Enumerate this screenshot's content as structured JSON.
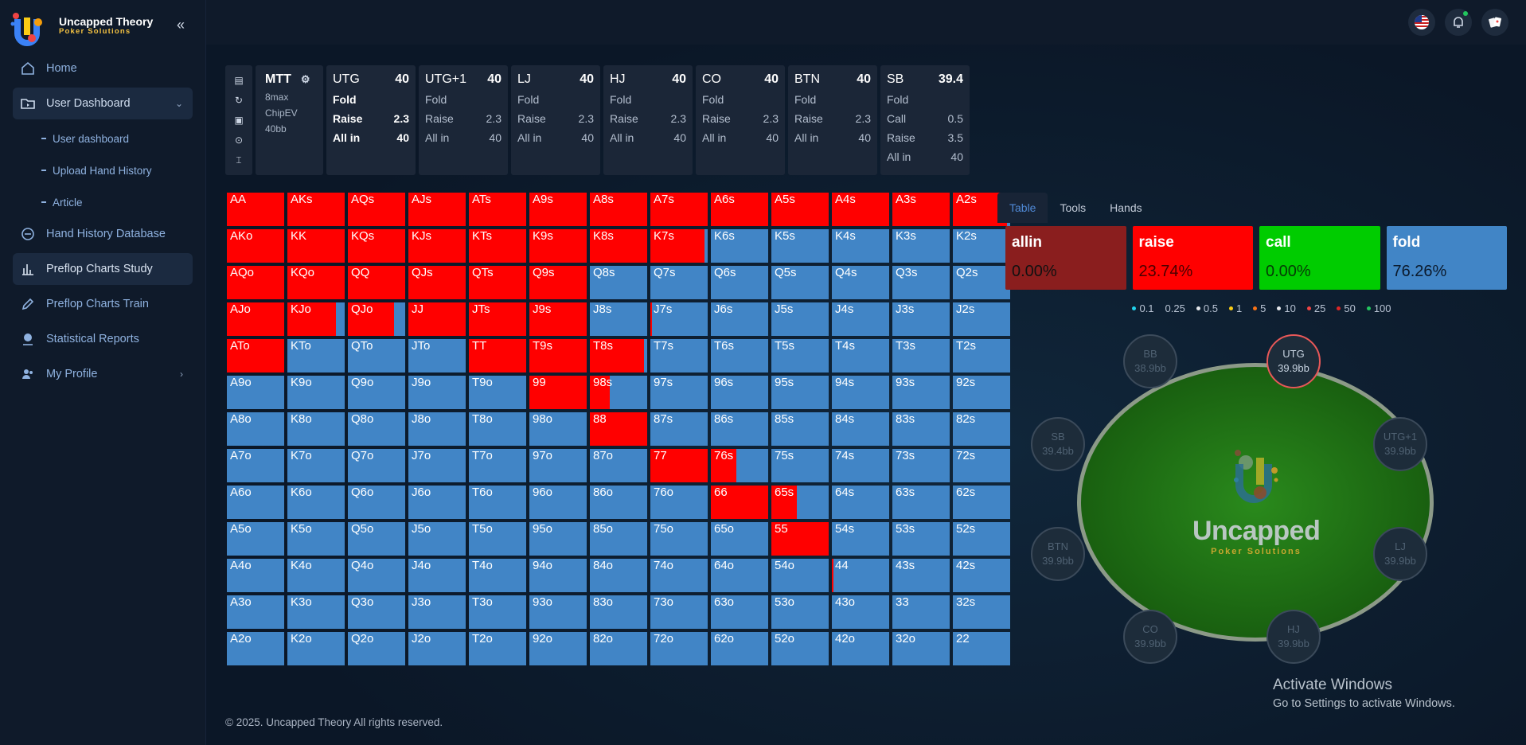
{
  "brand": {
    "title": "Uncapped Theory",
    "subtitle": "Poker Solutions"
  },
  "nav": {
    "home": "Home",
    "user_dashboard": "User Dashboard",
    "sub": [
      "User dashboard",
      "Upload Hand History",
      "Article"
    ],
    "hand_history_db": "Hand History Database",
    "preflop_study": "Preflop Charts Study",
    "preflop_train": "Preflop Charts Train",
    "statistical_reports": "Statistical Reports",
    "my_profile": "My Profile"
  },
  "icons": {
    "collapse": "double-chevron-left-icon",
    "flag": "us-flag-icon",
    "bell": "bell-icon",
    "cards": "cards-icon"
  },
  "game": {
    "title": "MTT",
    "format": "8max",
    "ev": "ChipEV",
    "depth": "40bb"
  },
  "positions": [
    {
      "name": "UTG",
      "stack": "40",
      "active": true,
      "options": [
        [
          "Fold",
          ""
        ],
        [
          "Raise",
          "2.3"
        ],
        [
          "All in",
          "40"
        ]
      ]
    },
    {
      "name": "UTG+1",
      "stack": "40",
      "options": [
        [
          "Fold",
          ""
        ],
        [
          "Raise",
          "2.3"
        ],
        [
          "All in",
          "40"
        ]
      ]
    },
    {
      "name": "LJ",
      "stack": "40",
      "options": [
        [
          "Fold",
          ""
        ],
        [
          "Raise",
          "2.3"
        ],
        [
          "All in",
          "40"
        ]
      ]
    },
    {
      "name": "HJ",
      "stack": "40",
      "options": [
        [
          "Fold",
          ""
        ],
        [
          "Raise",
          "2.3"
        ],
        [
          "All in",
          "40"
        ]
      ]
    },
    {
      "name": "CO",
      "stack": "40",
      "options": [
        [
          "Fold",
          ""
        ],
        [
          "Raise",
          "2.3"
        ],
        [
          "All in",
          "40"
        ]
      ]
    },
    {
      "name": "BTN",
      "stack": "40",
      "options": [
        [
          "Fold",
          ""
        ],
        [
          "Raise",
          "2.3"
        ],
        [
          "All in",
          "40"
        ]
      ]
    },
    {
      "name": "SB",
      "stack": "39.4",
      "options": [
        [
          "Fold",
          ""
        ],
        [
          "Call",
          "0.5"
        ],
        [
          "Raise",
          "3.5"
        ],
        [
          "All in",
          "40"
        ]
      ]
    }
  ],
  "grid": {
    "ranks": [
      "A",
      "K",
      "Q",
      "J",
      "T",
      "9",
      "8",
      "7",
      "6",
      "5",
      "4",
      "3",
      "2"
    ],
    "raise_fraction": [
      [
        1,
        1,
        1,
        1,
        1,
        1,
        1,
        1,
        1,
        1,
        1,
        1,
        0.95
      ],
      [
        1,
        1,
        1,
        1,
        1,
        1,
        1,
        0.95,
        0,
        0,
        0,
        0,
        0
      ],
      [
        1,
        1,
        1,
        1,
        1,
        1,
        0,
        0,
        0,
        0,
        0,
        0,
        0
      ],
      [
        1,
        0.85,
        0.8,
        1,
        1,
        1,
        0,
        0.03,
        0,
        0,
        0,
        0,
        0
      ],
      [
        1,
        0,
        0,
        0,
        1,
        1,
        0.95,
        0,
        0,
        0,
        0,
        0,
        0
      ],
      [
        0,
        0,
        0,
        0,
        0,
        1,
        0.35,
        0,
        0,
        0,
        0,
        0,
        0
      ],
      [
        0,
        0,
        0,
        0,
        0,
        0,
        1,
        0,
        0,
        0,
        0,
        0,
        0
      ],
      [
        0,
        0,
        0,
        0,
        0,
        0,
        0,
        1,
        0.45,
        0,
        0,
        0,
        0
      ],
      [
        0,
        0,
        0,
        0,
        0,
        0,
        0,
        0,
        1,
        0.45,
        0,
        0,
        0
      ],
      [
        0,
        0,
        0,
        0,
        0,
        0,
        0,
        0,
        0,
        1,
        0,
        0,
        0
      ],
      [
        0,
        0,
        0,
        0,
        0,
        0,
        0,
        0,
        0,
        0,
        0.03,
        0,
        0
      ],
      [
        0,
        0,
        0,
        0,
        0,
        0,
        0,
        0,
        0,
        0,
        0,
        0,
        0
      ],
      [
        0,
        0,
        0,
        0,
        0,
        0,
        0,
        0,
        0,
        0,
        0,
        0,
        0
      ]
    ]
  },
  "tabs": [
    "Table",
    "Tools",
    "Hands"
  ],
  "actions": [
    {
      "name": "allin",
      "pct": "0.00%",
      "bg": "#8a1e1e",
      "color": "#111111"
    },
    {
      "name": "raise",
      "pct": "23.74%",
      "bg": "#ff0000",
      "color": "#4a0000"
    },
    {
      "name": "call",
      "pct": "0.00%",
      "bg": "#00cc00",
      "color": "#063a06"
    },
    {
      "name": "fold",
      "pct": "76.26%",
      "bg": "#4185c6",
      "color": "#0b1a2c"
    }
  ],
  "legend": [
    {
      "label": "0.1",
      "color": "#22d3ee"
    },
    {
      "label": "0.25",
      "color": ""
    },
    {
      "label": "0.5",
      "color": "#e5e7eb"
    },
    {
      "label": "1",
      "color": "#facc15"
    },
    {
      "label": "5",
      "color": "#f97316"
    },
    {
      "label": "10",
      "color": "#e5e7eb"
    },
    {
      "label": "25",
      "color": "#ef4444"
    },
    {
      "label": "50",
      "color": "#dc2626"
    },
    {
      "label": "100",
      "color": "#22c55e"
    }
  ],
  "seats": {
    "bb": {
      "name": "BB",
      "stack": "38.9bb"
    },
    "utg": {
      "name": "UTG",
      "stack": "39.9bb"
    },
    "utg1": {
      "name": "UTG+1",
      "stack": "39.9bb"
    },
    "lj": {
      "name": "LJ",
      "stack": "39.9bb"
    },
    "hj": {
      "name": "HJ",
      "stack": "39.9bb"
    },
    "co": {
      "name": "CO",
      "stack": "39.9bb"
    },
    "btn": {
      "name": "BTN",
      "stack": "39.9bb"
    },
    "sb": {
      "name": "SB",
      "stack": "39.4bb"
    }
  },
  "felt": {
    "word": "Uncapped",
    "sub": "Poker Solutions"
  },
  "footer": "© 2025. Uncapped Theory All rights reserved.",
  "activate": {
    "title": "Activate Windows",
    "sub": "Go to Settings to activate Windows."
  }
}
